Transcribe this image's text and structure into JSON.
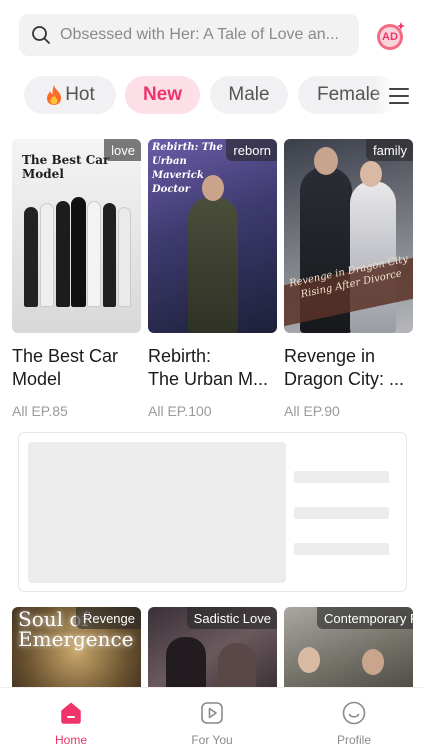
{
  "search": {
    "placeholder": "Obsessed with Her: A Tale of Love an..."
  },
  "header": {
    "ad_badge_text": "AD"
  },
  "tabs": [
    {
      "label": "Hot",
      "icon": "fire-icon",
      "active": false
    },
    {
      "label": "New",
      "active": true
    },
    {
      "label": "Male",
      "active": false
    },
    {
      "label": "Female",
      "active": false
    }
  ],
  "cards": [
    {
      "tag": "love",
      "poster_text": "The Best Car Model",
      "title_lines": [
        "The Best Car",
        "Model"
      ],
      "episodes": "All EP.85"
    },
    {
      "tag": "reborn",
      "poster_text": "Rebirth: The Urban Maverick Doctor",
      "title_lines": [
        "Rebirth:",
        "The Urban M..."
      ],
      "episodes": "All EP.100"
    },
    {
      "tag": "family",
      "poster_text": "Revenge in Dragon City Rising After Divorce",
      "title_lines": [
        "Revenge in",
        "Dragon City: ..."
      ],
      "episodes": "All EP.90"
    }
  ],
  "row2": [
    {
      "tag": "Revenge",
      "poster_text": "Soul of Emergence"
    },
    {
      "tag": "Sadistic Love"
    },
    {
      "tag": "Contemporary Romance"
    }
  ],
  "nav": [
    {
      "label": "Home",
      "icon": "home-icon",
      "active": true
    },
    {
      "label": "For You",
      "icon": "play-square-icon",
      "active": false
    },
    {
      "label": "Profile",
      "icon": "smile-face-icon",
      "active": false
    }
  ],
  "colors": {
    "accent": "#f0336b",
    "accent_light": "#fde0e7",
    "chip_bg": "#f1f1f3",
    "muted_text": "#9a9a9a"
  }
}
